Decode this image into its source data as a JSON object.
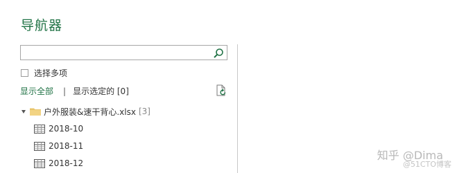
{
  "dialog": {
    "title": "导航器"
  },
  "search": {
    "value": "",
    "placeholder": ""
  },
  "options": {
    "select_multiple_label": "选择多项"
  },
  "filter": {
    "show_all_label": "显示全部",
    "separator": "|",
    "show_selected_label": "显示选定的 [0]"
  },
  "tree": {
    "root": {
      "name": "户外服装&速干背心.xlsx",
      "count": "[3]",
      "icon": "folder-icon"
    },
    "sheets": [
      {
        "name": "2018-10",
        "icon": "table-icon"
      },
      {
        "name": "2018-11",
        "icon": "table-icon"
      },
      {
        "name": "2018-12",
        "icon": "table-icon"
      }
    ]
  },
  "watermark": {
    "text": "知乎 @Dima",
    "sub": "@51CTO博客"
  },
  "colors": {
    "accent": "#217346",
    "folder": "#e8c46a"
  }
}
